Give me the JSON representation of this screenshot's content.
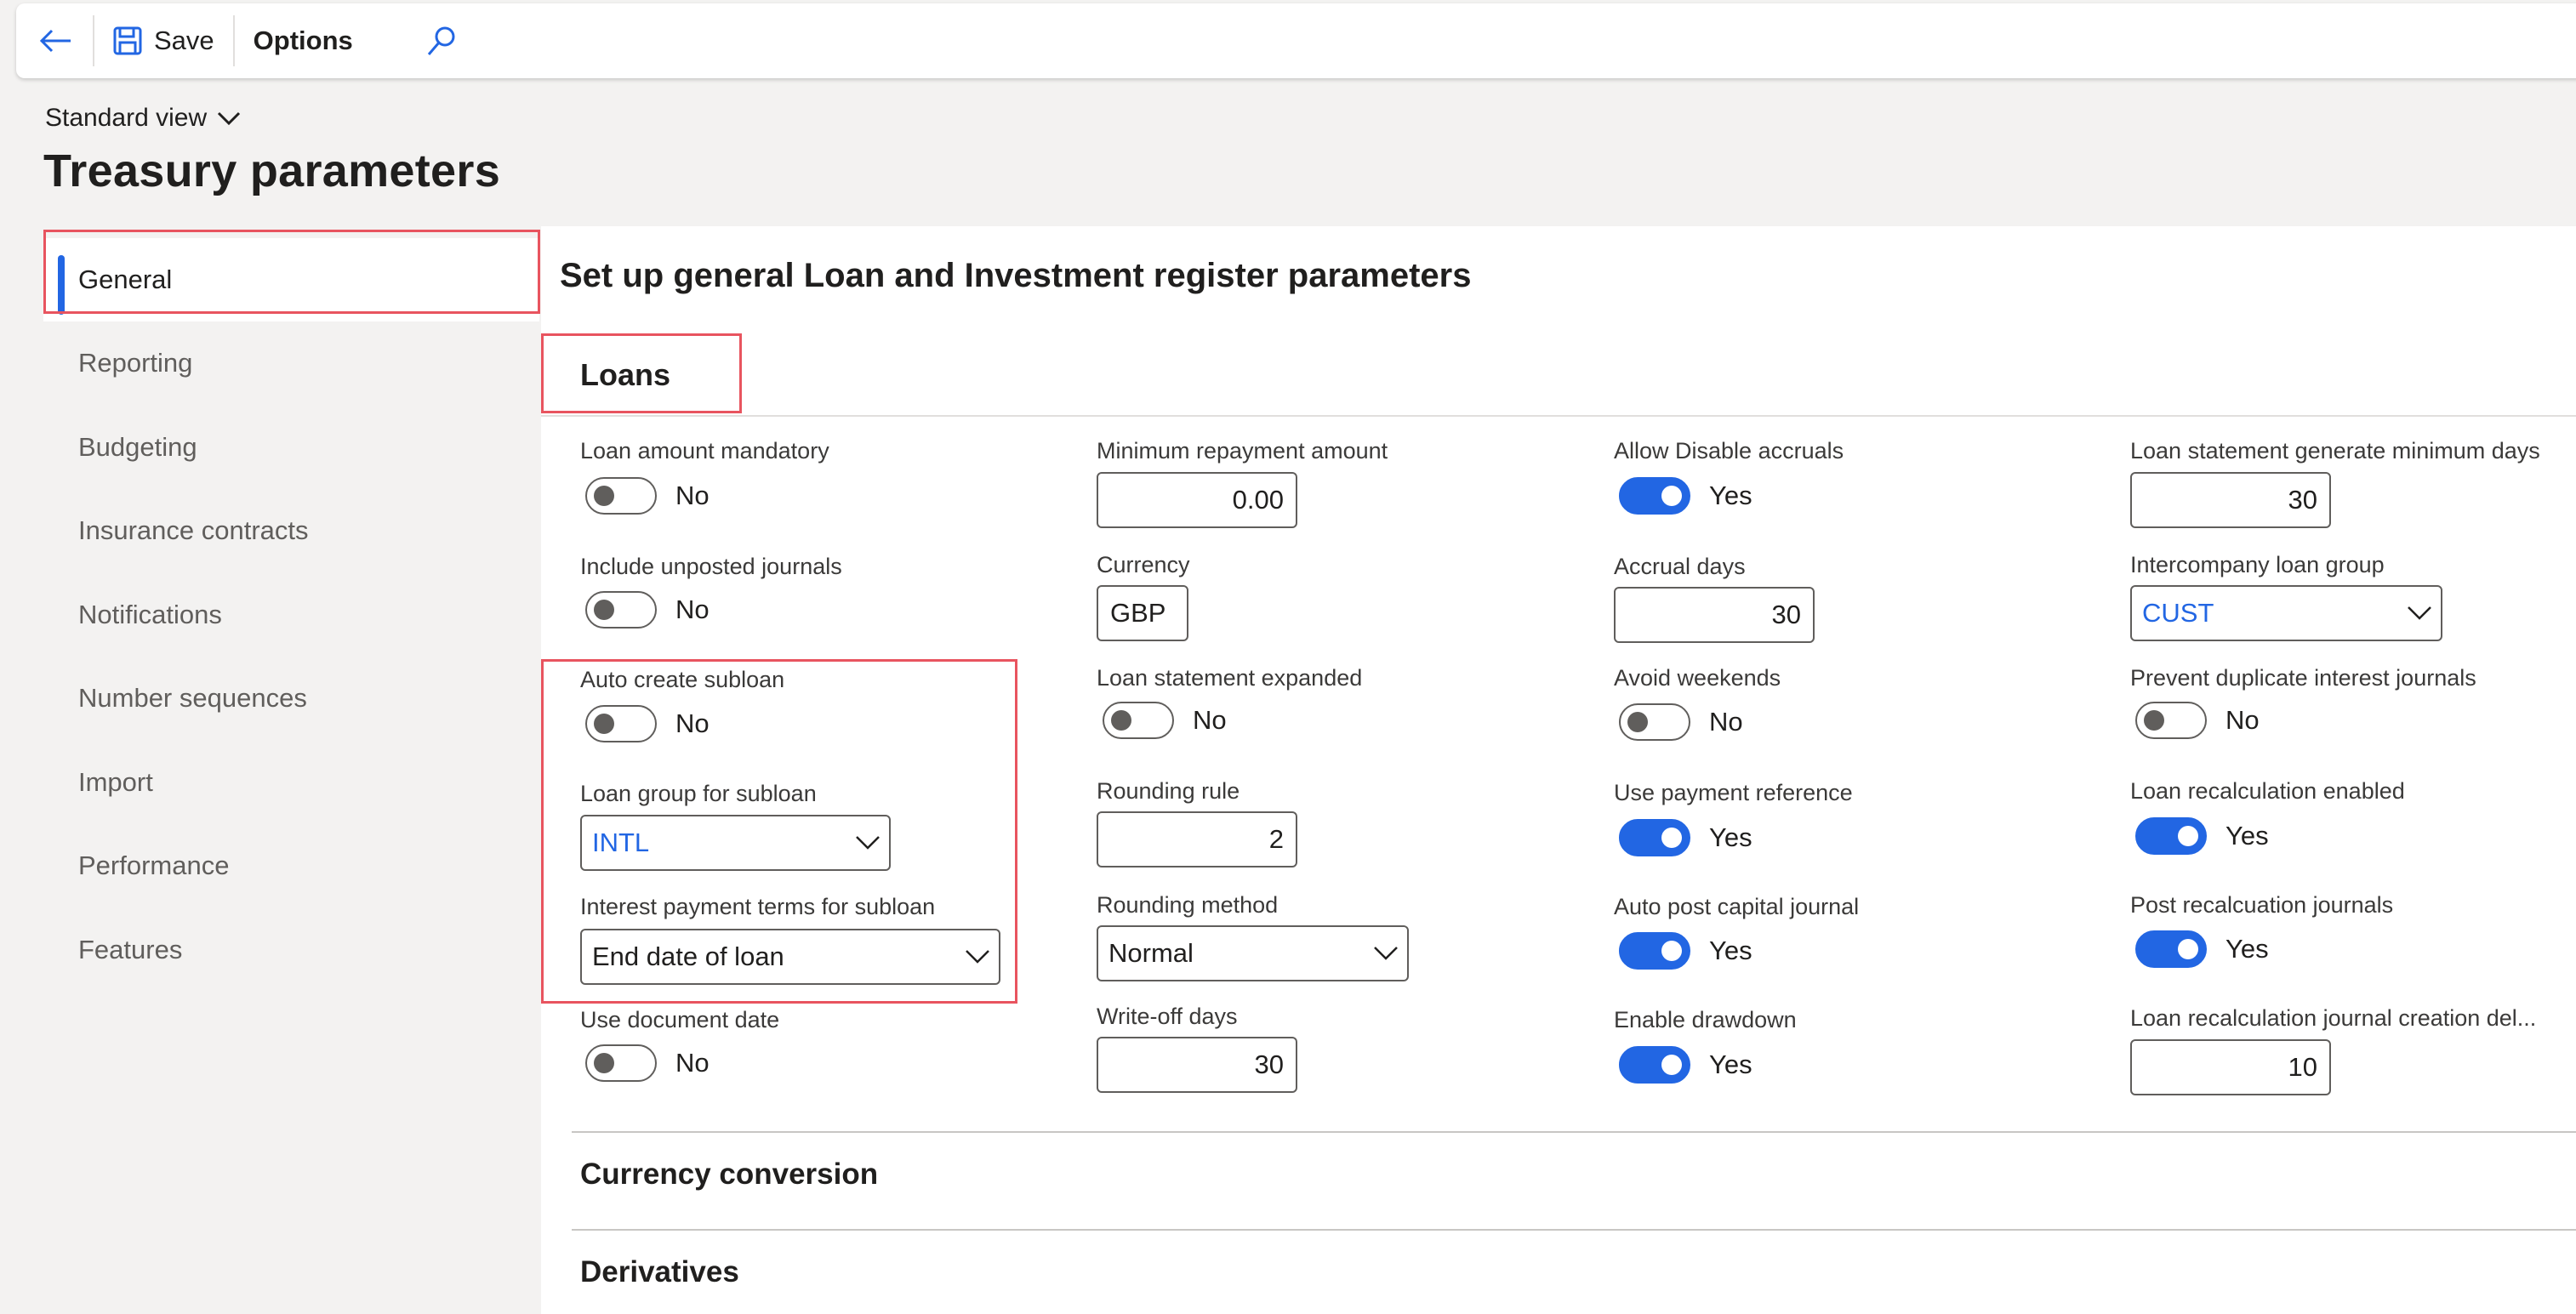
{
  "toolbar": {
    "back_label": "",
    "save_label": "Save",
    "options_label": "Options"
  },
  "header": {
    "view_label": "Standard view",
    "title": "Treasury parameters"
  },
  "sidebar": {
    "items": [
      {
        "label": "General"
      },
      {
        "label": "Reporting"
      },
      {
        "label": "Budgeting"
      },
      {
        "label": "Insurance contracts"
      },
      {
        "label": "Notifications"
      },
      {
        "label": "Number sequences"
      },
      {
        "label": "Import"
      },
      {
        "label": "Performance"
      },
      {
        "label": "Features"
      }
    ]
  },
  "main": {
    "section_title": "Set up general Loan and Investment register parameters",
    "tab_loans": "Loans",
    "col1": {
      "loan_amount_mandatory": {
        "label": "Loan amount mandatory",
        "value": "No"
      },
      "include_unposted": {
        "label": "Include unposted journals",
        "value": "No"
      },
      "auto_create_subloan": {
        "label": "Auto create subloan",
        "value": "No"
      },
      "loan_group_subloan": {
        "label": "Loan group for subloan",
        "value": "INTL"
      },
      "interest_terms_subloan": {
        "label": "Interest payment terms for subloan",
        "value": "End date of loan"
      },
      "use_document_date": {
        "label": "Use document date",
        "value": "No"
      }
    },
    "col2": {
      "min_repayment": {
        "label": "Minimum repayment amount",
        "value": "0.00"
      },
      "currency": {
        "label": "Currency",
        "value": "GBP"
      },
      "statement_expanded": {
        "label": "Loan statement expanded",
        "value": "No"
      },
      "rounding_rule": {
        "label": "Rounding rule",
        "value": "2"
      },
      "rounding_method": {
        "label": "Rounding method",
        "value": "Normal"
      },
      "writeoff_days": {
        "label": "Write-off days",
        "value": "30"
      }
    },
    "col3": {
      "allow_disable_accruals": {
        "label": "Allow Disable accruals",
        "value": "Yes"
      },
      "accrual_days": {
        "label": "Accrual days",
        "value": "30"
      },
      "avoid_weekends": {
        "label": "Avoid weekends",
        "value": "No"
      },
      "use_payment_ref": {
        "label": "Use payment reference",
        "value": "Yes"
      },
      "auto_post_capital": {
        "label": "Auto post capital journal",
        "value": "Yes"
      },
      "enable_drawdown": {
        "label": "Enable drawdown",
        "value": "Yes"
      }
    },
    "col4": {
      "statement_min_days": {
        "label": "Loan statement generate minimum days",
        "value": "30"
      },
      "intercompany_group": {
        "label": "Intercompany loan group",
        "value": "CUST"
      },
      "prevent_duplicate": {
        "label": "Prevent duplicate interest journals",
        "value": "No"
      },
      "recalc_enabled": {
        "label": "Loan recalculation enabled",
        "value": "Yes"
      },
      "post_recalc": {
        "label": "Post recalcuation journals",
        "value": "Yes"
      },
      "recalc_delay": {
        "label": "Loan recalculation journal creation del...",
        "value": "10"
      }
    },
    "sub_sections": {
      "currency_conversion": "Currency conversion",
      "derivatives": "Derivatives"
    }
  },
  "colors": {
    "accent": "#2266e3",
    "highlight": "#e8545f"
  }
}
